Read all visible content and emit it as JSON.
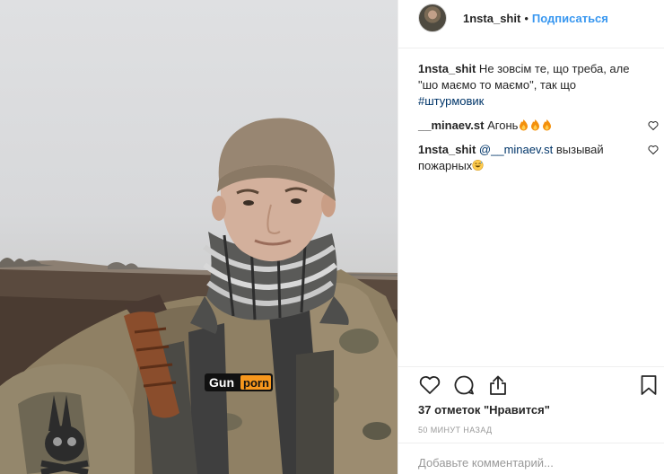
{
  "post": {
    "username": "1nsta_shit",
    "separator": "•",
    "follow_label": "Подписаться"
  },
  "comments": [
    {
      "username": "1nsta_shit",
      "text": " Не зовсім те, що треба, але \"шо маємо то маємо\", так що ",
      "hashtag": "#штурмовик"
    },
    {
      "username": "__minaev.st",
      "text": " Агонь"
    },
    {
      "username": "1nsta_shit",
      "mention": " @__minaev.st",
      "text": " вызывай пожарных"
    }
  ],
  "photo": {
    "patch_text_left": "Gun",
    "patch_text_right": "porn"
  },
  "likes": {
    "count_text": "37 отметок ",
    "quote_text": "\"Нравится\""
  },
  "time_text": "50 МИНУТ НАЗАД",
  "add_comment": {
    "placeholder": "Добавьте комментарий..."
  },
  "colors": {
    "link_blue": "#3897f0",
    "text": "#262626",
    "muted": "#999999",
    "divider": "#efefef",
    "patch_orange": "#f7971d"
  },
  "icons": {
    "like": "heart-icon",
    "comment": "speech-bubble-icon",
    "share": "share-arrow-icon",
    "save": "bookmark-icon",
    "comment_like": "small-heart-icon"
  }
}
